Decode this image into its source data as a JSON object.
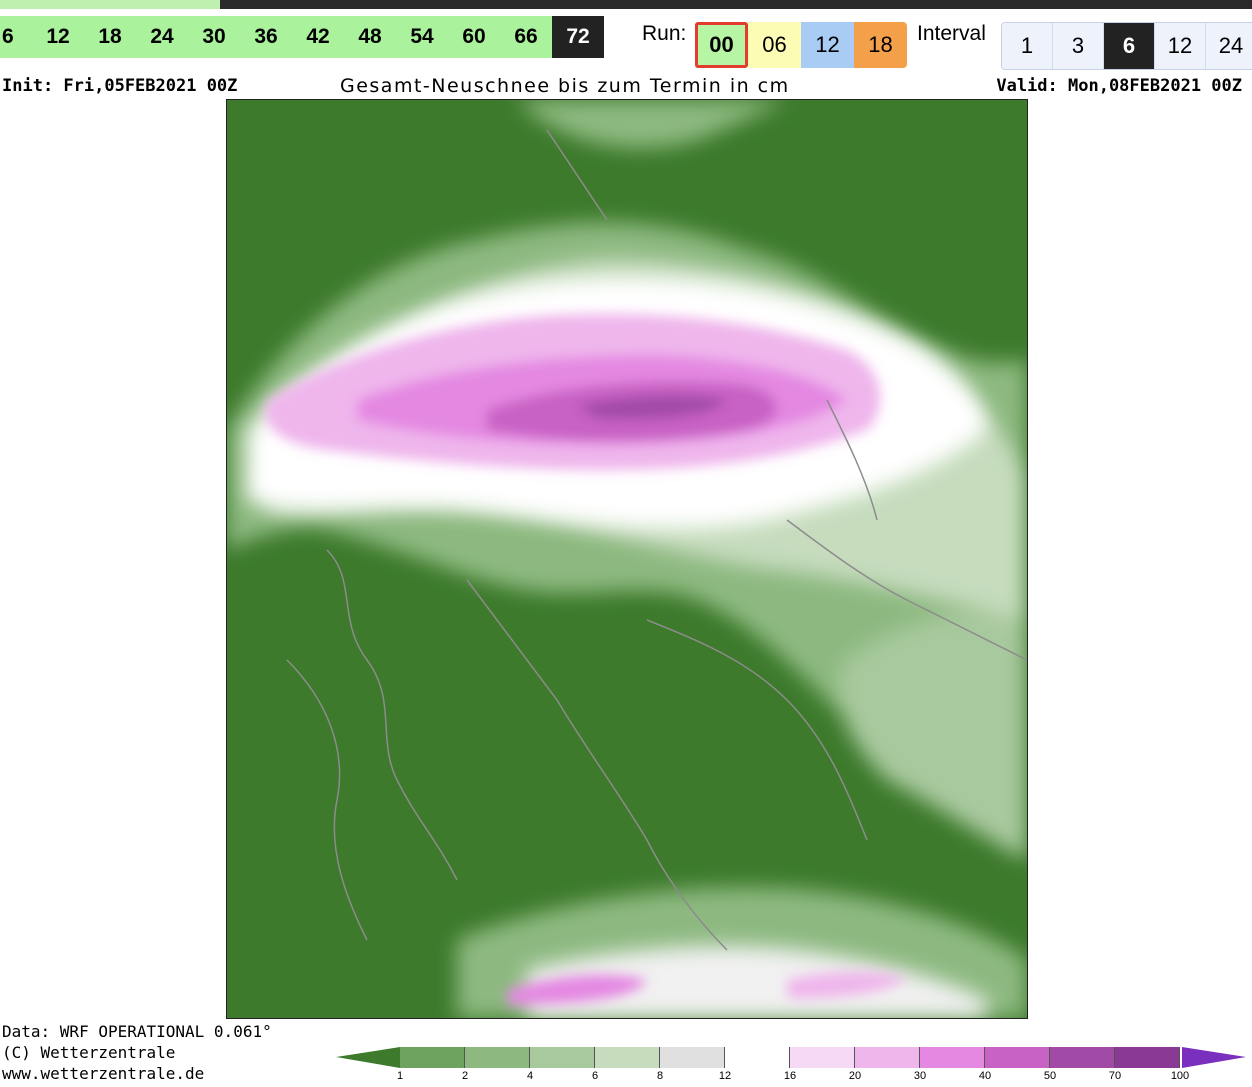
{
  "header": {
    "hours": [
      "6",
      "12",
      "18",
      "24",
      "30",
      "36",
      "42",
      "48",
      "54",
      "60",
      "66",
      "72"
    ],
    "active_hour": "72",
    "run_label": "Run:",
    "runs": [
      "00",
      "06",
      "12",
      "18"
    ],
    "active_run": "00",
    "interval_label": "Interval",
    "intervals": [
      "1",
      "3",
      "6",
      "12",
      "24"
    ],
    "active_interval": "6"
  },
  "meta": {
    "init": "Init: Fri,05FEB2021 00Z",
    "title": "Gesamt-Neuschnee bis zum Termin in cm",
    "valid": "Valid: Mon,08FEB2021 00Z"
  },
  "map": {
    "land_color": "#3d7a2c",
    "snow_colors": [
      "#6da25f",
      "#8db980",
      "#a8c99e",
      "#c6dcbd",
      "#e0e0e0",
      "#ffffff",
      "#f6d9f4",
      "#efb6ec",
      "#e488e2",
      "#c862c4",
      "#a14aa6",
      "#8a3a94",
      "#7b2fbf"
    ]
  },
  "footer": {
    "line1": "Data: WRF OPERATIONAL 0.061°",
    "line2": "(C) Wetterzentrale",
    "line3": "www.wetterzentrale.de"
  },
  "legend": {
    "ticks": [
      "1",
      "2",
      "4",
      "6",
      "8",
      "12",
      "16",
      "20",
      "30",
      "40",
      "50",
      "70",
      "100"
    ]
  }
}
